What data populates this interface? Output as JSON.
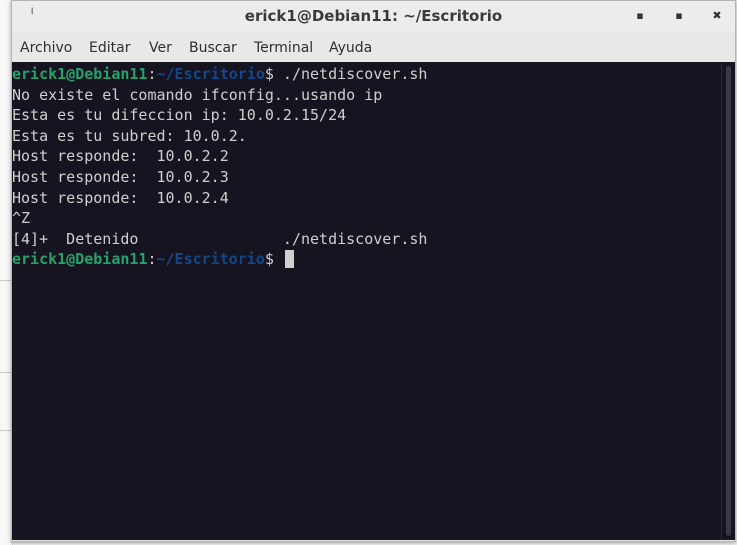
{
  "window": {
    "title": "erick1@Debian11: ~/Escritorio",
    "icon": "terminal-window-icon",
    "controls": {
      "minimize": "minimize-icon",
      "maximize": "maximize-icon",
      "close": "close-icon"
    }
  },
  "menubar": {
    "items": [
      {
        "label": "Archivo"
      },
      {
        "label": "Editar"
      },
      {
        "label": "Ver"
      },
      {
        "label": "Buscar"
      },
      {
        "label": "Terminal"
      },
      {
        "label": "Ayuda"
      }
    ]
  },
  "terminal": {
    "colors": {
      "background": "#171421",
      "foreground": "#d0cfcc",
      "prompt_user": "#26a269",
      "prompt_path": "#12488b"
    },
    "prompt": {
      "user_host": "erick1@Debian11",
      "separator": ":",
      "path": "~/Escritorio",
      "sign": "$"
    },
    "first_command": " ./netdiscover.sh",
    "output": [
      "No existe el comando ifconfig...usando ip",
      "Esta es tu difeccion ip: 10.0.2.15/24",
      "Esta es tu subred: 10.0.2.",
      "Host responde:  10.0.2.2",
      "Host responde:  10.0.2.3",
      "Host responde:  10.0.2.4",
      "^Z",
      "[4]+  Detenido                ./netdiscover.sh"
    ]
  }
}
